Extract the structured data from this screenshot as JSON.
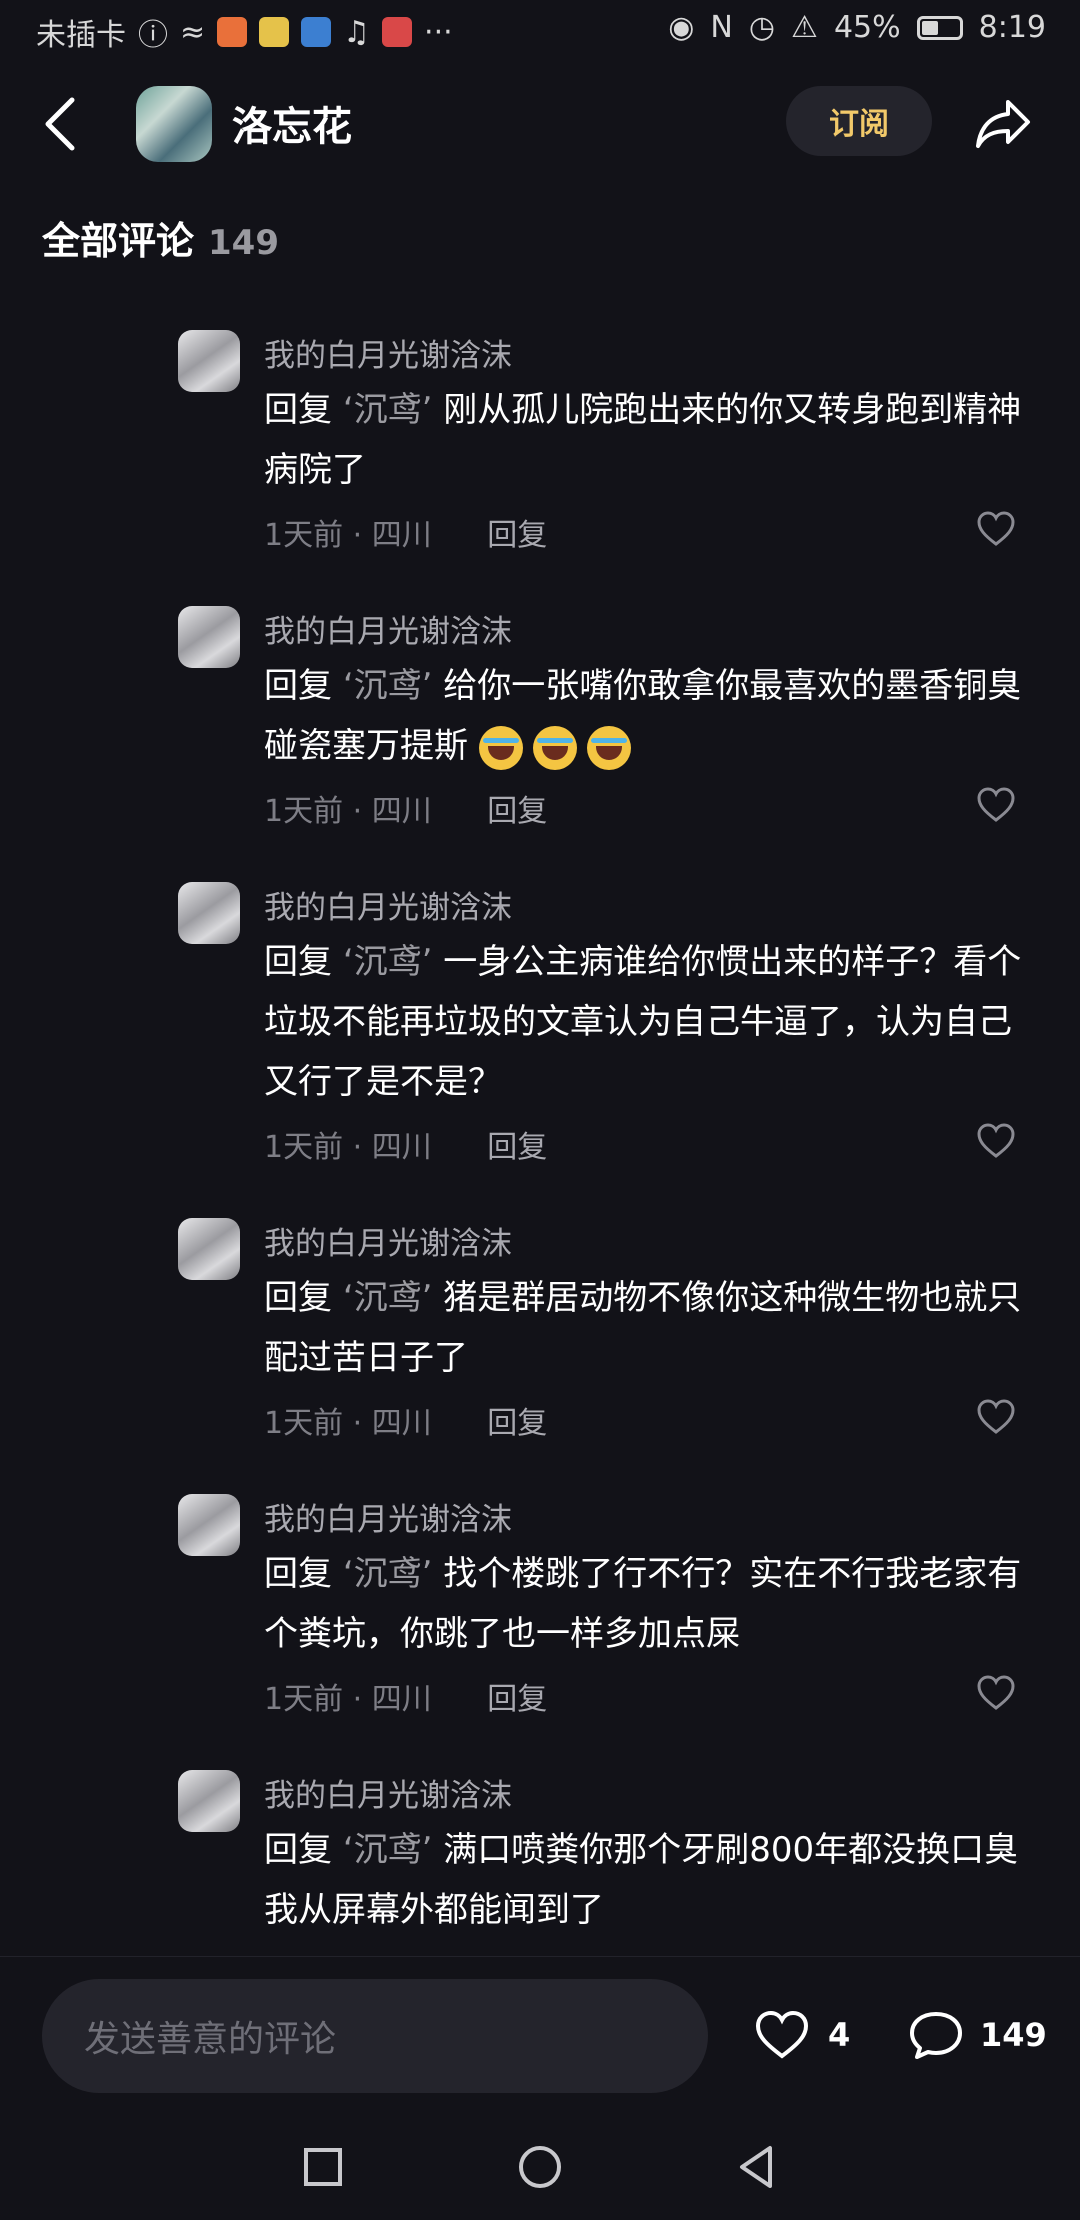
{
  "status_bar": {
    "carrier": "未插卡",
    "battery": "45%",
    "battery_level": 0.45,
    "time": "8:19",
    "more": "···"
  },
  "header": {
    "title": "洛忘花",
    "subscribe_label": "订阅"
  },
  "comments_section": {
    "title": "全部评论",
    "count": "149"
  },
  "comments": [
    {
      "author": "我的白月光谢浛沫",
      "reply_prefix": "回复",
      "target": "‘沉鸢’",
      "text": "刚从孤儿院跑出来的你又转身跑到精神病院了",
      "time": "1天前",
      "sep": "·",
      "location": "四川",
      "reply_label": "回复"
    },
    {
      "author": "我的白月光谢浛沫",
      "reply_prefix": "回复",
      "target": "‘沉鸢’",
      "text": "给你一张嘴你敢拿你最喜欢的墨香铜臭碰瓷塞万提斯",
      "emoji_count": 3,
      "emoji_name": "laughing-crying-emoji",
      "time": "1天前",
      "sep": "·",
      "location": "四川",
      "reply_label": "回复"
    },
    {
      "author": "我的白月光谢浛沫",
      "reply_prefix": "回复",
      "target": "‘沉鸢’",
      "text": "一身公主病谁给你惯出来的样子？看个垃圾不能再垃圾的文章认为自己牛逼了，认为自己又行了是不是？",
      "time": "1天前",
      "sep": "·",
      "location": "四川",
      "reply_label": "回复"
    },
    {
      "author": "我的白月光谢浛沫",
      "reply_prefix": "回复",
      "target": "‘沉鸢’",
      "text": "猪是群居动物不像你这种微生物也就只配过苦日子了",
      "time": "1天前",
      "sep": "·",
      "location": "四川",
      "reply_label": "回复"
    },
    {
      "author": "我的白月光谢浛沫",
      "reply_prefix": "回复",
      "target": "‘沉鸢’",
      "text": "找个楼跳了行不行？实在不行我老家有个粪坑，你跳了也一样多加点屎",
      "time": "1天前",
      "sep": "·",
      "location": "四川",
      "reply_label": "回复"
    },
    {
      "author": "我的白月光谢浛沫",
      "reply_prefix": "回复",
      "target": "‘沉鸢’",
      "text": "满口喷粪你那个牙刷800年都没换口臭我从屏幕外都能闻到了"
    }
  ],
  "bottom_bar": {
    "input_placeholder": "发送善意的评论",
    "likes_count": "4",
    "comments_count": "149"
  },
  "colors": {
    "background": "#121218",
    "subscribe_text": "#f2c96a",
    "muted_text": "#7e7e86"
  }
}
